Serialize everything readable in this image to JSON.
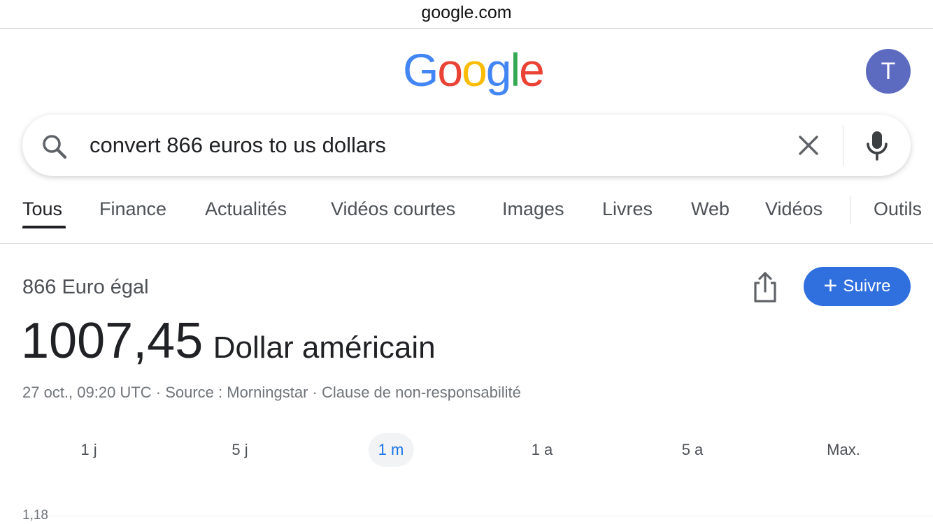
{
  "browser": {
    "url": "google.com"
  },
  "header": {
    "logo_letters": [
      {
        "char": "G",
        "color": "#4285F4"
      },
      {
        "char": "o",
        "color": "#EA4335"
      },
      {
        "char": "o",
        "color": "#FBBC05"
      },
      {
        "char": "g",
        "color": "#4285F4"
      },
      {
        "char": "l",
        "color": "#34A853"
      },
      {
        "char": "e",
        "color": "#EA4335"
      }
    ],
    "avatar_initial": "T",
    "avatar_color": "#5c6bc0"
  },
  "search": {
    "query": "convert 866 euros to us dollars",
    "icons": [
      "search-icon",
      "close-icon",
      "microphone-icon"
    ]
  },
  "tabs": [
    {
      "label": "Tous",
      "active": true
    },
    {
      "label": "Finance"
    },
    {
      "label": "Actualités"
    },
    {
      "label": "Vidéos courtes"
    },
    {
      "label": "Images"
    },
    {
      "label": "Livres"
    },
    {
      "label": "Web"
    },
    {
      "label": "Vidéos"
    },
    {
      "label": "Outils"
    }
  ],
  "converter": {
    "label": "866 Euro égal",
    "value": "1007,45",
    "unit": "Dollar américain",
    "meta": "27 oct., 09:20 UTC · Source : Morningstar · Clause de non-responsabilité",
    "follow_label": "Suivre",
    "follow_color": "#2f6fde",
    "ranges": [
      {
        "label": "1 j"
      },
      {
        "label": "5 j"
      },
      {
        "label": "1 m",
        "active": true
      },
      {
        "label": "1 a"
      },
      {
        "label": "5 a"
      },
      {
        "label": "Max."
      }
    ],
    "active_range_color": "#1a73e8"
  },
  "chart_data": {
    "type": "line",
    "y_tick_labels": [
      "1,18"
    ]
  }
}
